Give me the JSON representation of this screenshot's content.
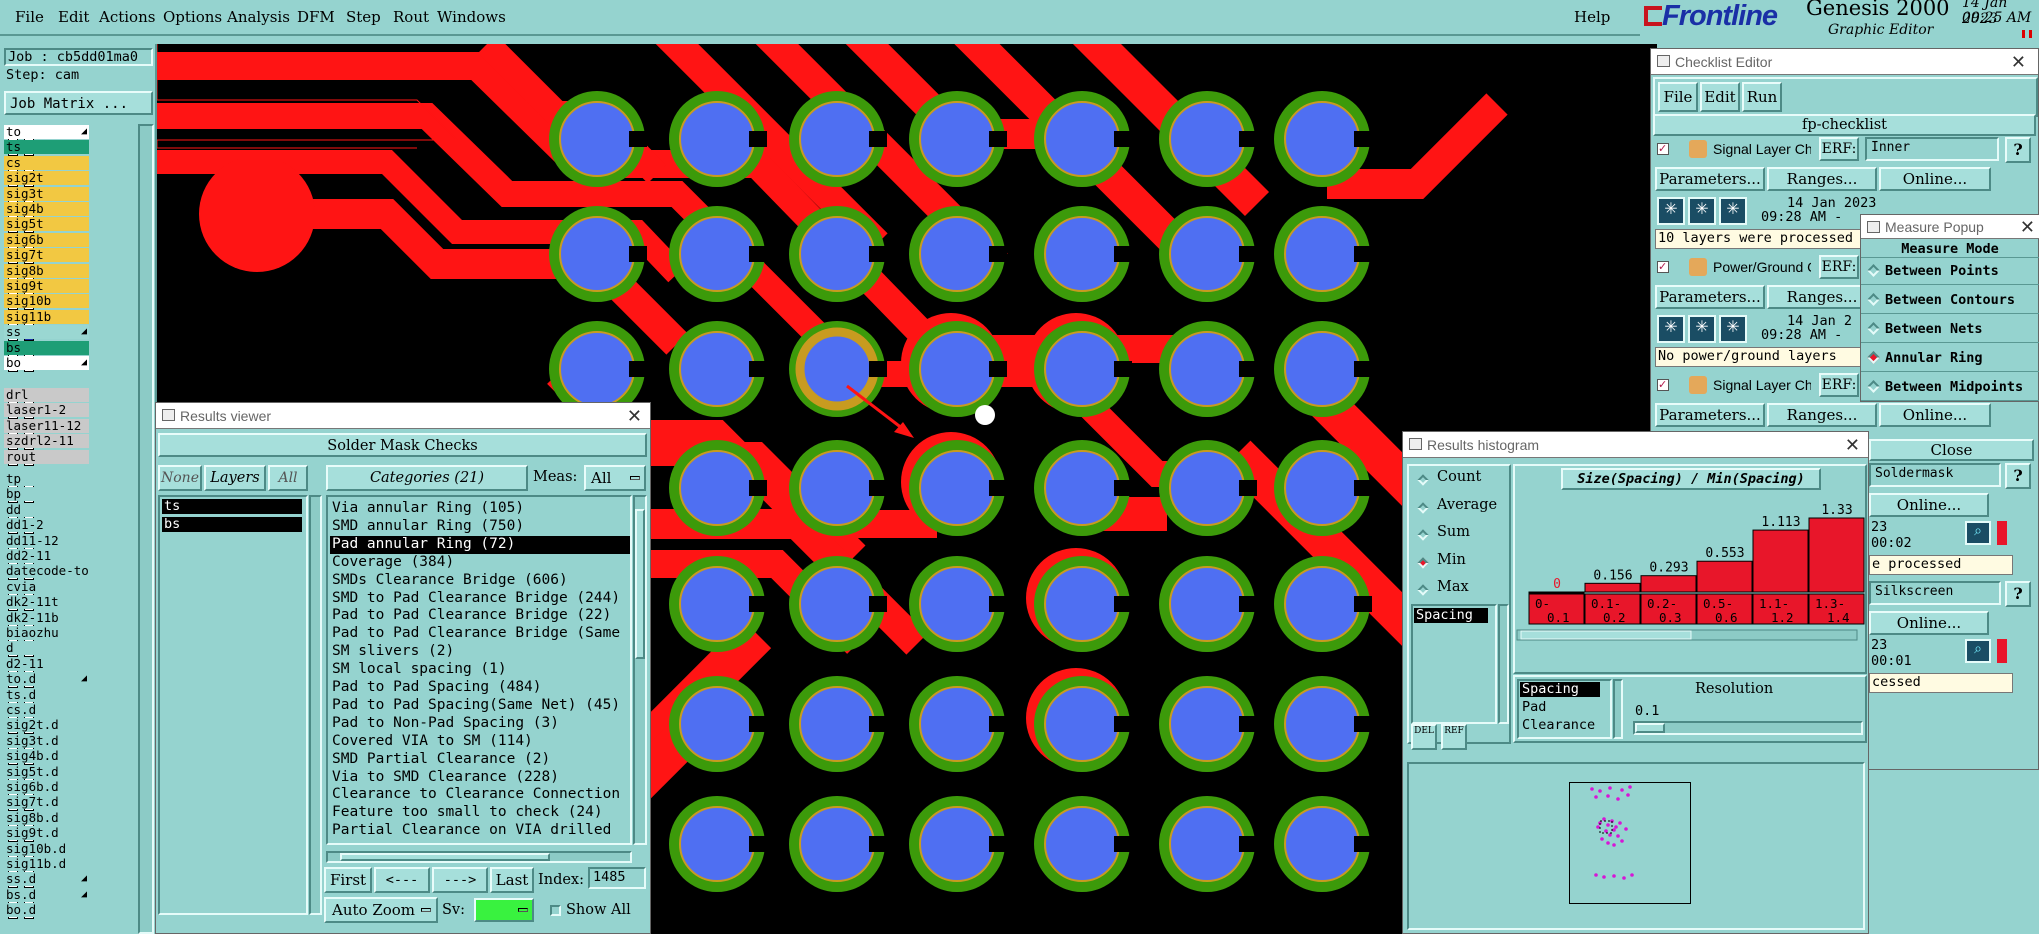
{
  "app": {
    "name": "Genesis 2000",
    "subtitle": "Graphic Editor",
    "brand": "Frontline",
    "date": "14 Jan 2023",
    "time": "09:25 AM"
  },
  "menu": [
    "File",
    "Edit",
    "Actions",
    "Options",
    "Analysis",
    "DFM",
    "Step",
    "Rout",
    "Windows"
  ],
  "help": "Help",
  "job": {
    "job": "Job : cb5dd01ma0",
    "step": "Step: cam",
    "matrix": "Job Matrix ..."
  },
  "layers_g1": [
    {
      "n": "to",
      "c": "#ffffff",
      "a": true
    },
    {
      "n": "ts",
      "c": "#1e9e76"
    },
    {
      "n": "cs",
      "c": "#f2c842"
    },
    {
      "n": "sig2t",
      "c": "#f2c842"
    },
    {
      "n": "sig3t",
      "c": "#f2c842"
    },
    {
      "n": "sig4b",
      "c": "#f2c842"
    },
    {
      "n": "sig5t",
      "c": "#f2c842"
    },
    {
      "n": "sig6b",
      "c": "#f2c842"
    },
    {
      "n": "sig7t",
      "c": "#f2c842"
    },
    {
      "n": "sig8b",
      "c": "#f2c842"
    },
    {
      "n": "sig9t",
      "c": "#f2c842"
    },
    {
      "n": "sig10b",
      "c": "#f2c842"
    },
    {
      "n": "sig11b",
      "c": "#f2c842"
    },
    {
      "n": "ss",
      "c": "#9ad7d2",
      "a": true
    },
    {
      "n": "bs",
      "c": "#1e9e76"
    },
    {
      "n": "bo",
      "c": "#ffffff",
      "a": true
    }
  ],
  "layers_g2": [
    "drl",
    "laser1-2",
    "laser11-12",
    "szdrl2-11",
    "rout"
  ],
  "layers_g3": [
    "tp",
    "bp",
    "dd",
    "dd1-2",
    "dd11-12",
    "dd2-11",
    "datecode-to",
    "cvia",
    "dk2-11t",
    "dk2-11b",
    "biaozhu",
    "d",
    "d2-11",
    "to.d",
    "ts.d",
    "cs.d",
    "sig2t.d",
    "sig3t.d",
    "sig4b.d",
    "sig5t.d",
    "sig6b.d",
    "sig7t.d",
    "sig8b.d",
    "sig9t.d",
    "sig10b.d",
    "sig11b.d",
    "ss.d",
    "bs.d",
    "bo.d"
  ],
  "results": {
    "title": "Results viewer",
    "heading": "Solder Mask Checks",
    "none": "None",
    "layers": "Layers",
    "all": "All",
    "layer_items": [
      "ts",
      "bs"
    ],
    "categories": "Categories (21)",
    "meas_label": "Meas:",
    "meas_value": "All",
    "items": [
      "Via annular Ring (105)",
      "SMD annular Ring (750)",
      "Pad annular Ring (72)",
      "Coverage (384)",
      "SMDs Clearance Bridge (606)",
      "SMD to Pad Clearance Bridge (244)",
      "Pad to Pad Clearance Bridge (22)",
      "Pad to Pad Clearance Bridge (Same",
      "SM slivers (2)",
      "SM local spacing (1)",
      "Pad to Pad Spacing (484)",
      "Pad to Pad Spacing(Same Net) (45)",
      "Pad to Non-Pad Spacing (3)",
      "Covered VIA to SM (114)",
      "SMD Partial Clearance (2)",
      "Via to SMD Clearance (228)",
      "Clearance to Clearance Connection",
      "Feature too small to check (24)",
      "Partial Clearance on VIA drilled"
    ],
    "selected": 2,
    "first": "First",
    "prev": "<---",
    "next": "--->",
    "last": "Last",
    "index_label": "Index:",
    "index_value": "1485",
    "zoom": "Auto Zoom",
    "sv": "Sv:",
    "show_all": "Show All"
  },
  "checklist": {
    "title": "Checklist Editor",
    "menu": [
      "File",
      "Edit",
      "Run"
    ],
    "name": "fp-checklist",
    "rows": [
      {
        "name": "Signal Layer Ch",
        "erf": "ERF:",
        "field": "Inner",
        "date": "14 Jan 2023",
        "time": "09:28 AM -",
        "msg": "10 layers were processed"
      },
      {
        "name": "Power/Ground C",
        "erf": "ERF:",
        "field": "",
        "date": "14 Jan 2",
        "time": "09:28 AM -",
        "msg": "No power/ground layers"
      },
      {
        "name": "Signal Layer Ch",
        "erf": "ERF:",
        "field": "",
        "date": "",
        "time": "",
        "msg": ""
      }
    ],
    "params": "Parameters...",
    "ranges": "Ranges...",
    "online": "Online...",
    "close": "Close",
    "lower": [
      {
        "field": "Soldermask",
        "date": "23",
        "time": "00:02",
        "msg": "e processed"
      },
      {
        "field": "Silkscreen",
        "date": "23",
        "time": "00:01",
        "msg": "cessed"
      }
    ]
  },
  "measure": {
    "title": "Measure Popup",
    "heading": "Measure Mode",
    "options": [
      "Between Points",
      "Between Contours",
      "Between Nets",
      "Annular Ring",
      "Between Midpoints"
    ],
    "selected": 3
  },
  "histogram": {
    "title": "Results histogram",
    "options": [
      "Count",
      "Average",
      "Sum",
      "Min",
      "Max"
    ],
    "selected": 3,
    "list": [
      "Spacing"
    ],
    "chart_title": "Size(Spacing) / Min(Spacing)",
    "sort_items": [
      "Spacing",
      "Pad",
      "Clearance"
    ],
    "resolution_label": "Resolution",
    "resolution": "0.1",
    "bottom_buttons": [
      "DEL",
      "REF"
    ]
  },
  "chart_data": {
    "type": "bar",
    "title": "Size(Spacing) / Min(Spacing)",
    "categories": [
      "0-0.1",
      "0.1-0.2",
      "0.2-0.3",
      "0.5-0.6",
      "1.1-1.2",
      "1.3-1.4"
    ],
    "values": [
      0,
      0.156,
      0.293,
      0.553,
      1.113,
      1.33
    ],
    "labels": [
      "0",
      "0.156",
      "0.293",
      "0.553",
      "1.113",
      "1.33"
    ],
    "color": "#e8162a"
  },
  "colors": {
    "bg": "#95d3cf",
    "copper": "#ff1414",
    "mask": "#3c9a0a",
    "pad": "#4f6ff2",
    "edge": "#c89b20"
  }
}
